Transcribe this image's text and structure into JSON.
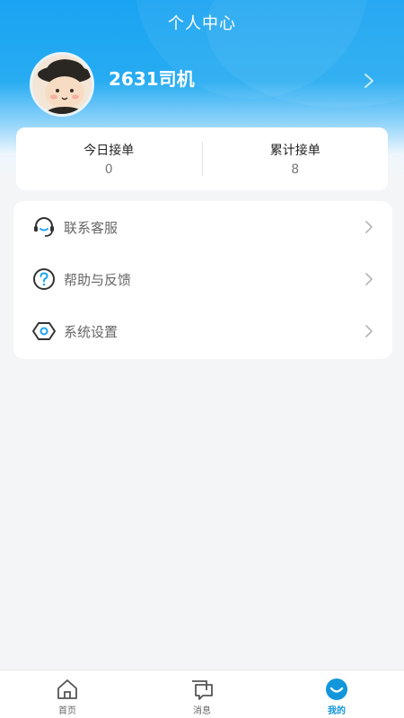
{
  "header": {
    "title": "个人中心",
    "username": "2631司机"
  },
  "stats": {
    "today_label": "今日接单",
    "today_value": "0",
    "total_label": "累计接单",
    "total_value": "8"
  },
  "menu": [
    {
      "label": "联系客服",
      "icon": "headset-icon"
    },
    {
      "label": "帮助与反馈",
      "icon": "question-circle-icon"
    },
    {
      "label": "系统设置",
      "icon": "hexagon-settings-icon"
    }
  ],
  "tabbar": {
    "home": "首页",
    "messages": "消息",
    "mine": "我的",
    "active": "mine"
  },
  "colors": {
    "accent": "#1296db",
    "header_top": "#1aa3f2",
    "background": "#f4f5f7"
  }
}
